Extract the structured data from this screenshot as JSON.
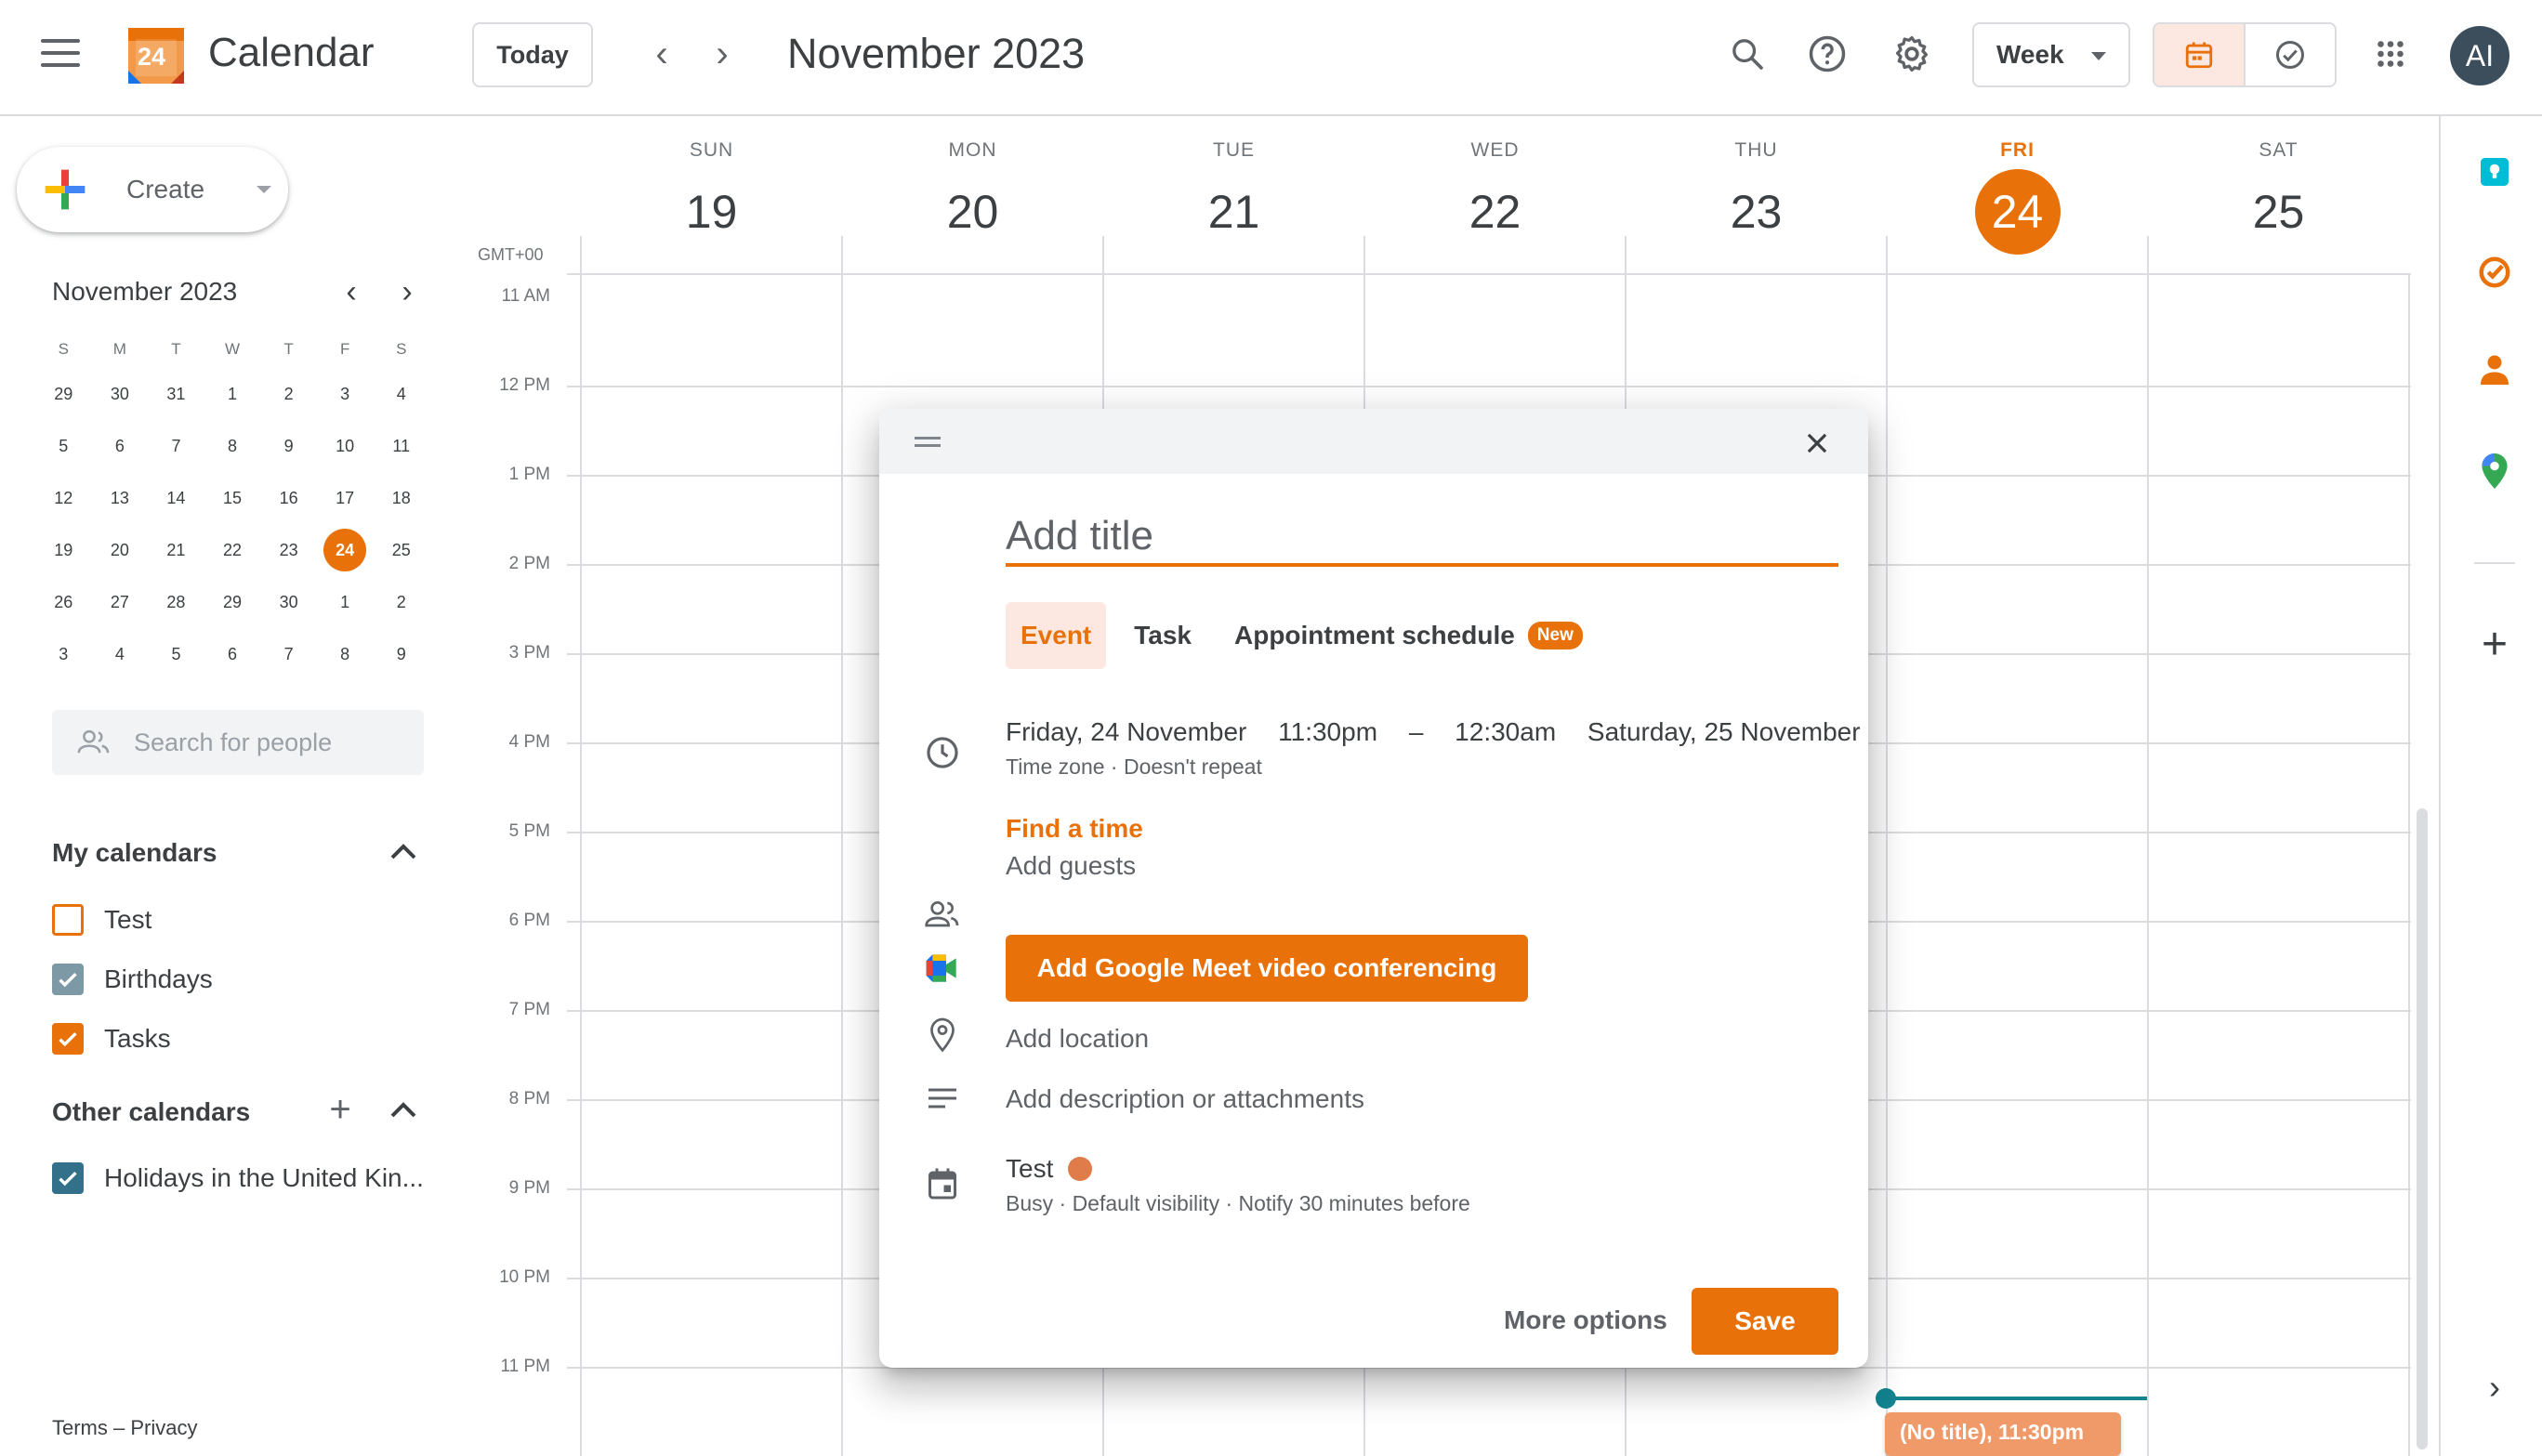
{
  "header": {
    "app_title": "Calendar",
    "logo_day": "24",
    "today_label": "Today",
    "current_period": "November 2023",
    "view_label": "Week",
    "avatar_initials": "AI",
    "accent_color": "#e8710a"
  },
  "sidebar": {
    "create_label": "Create",
    "mini_calendar": {
      "title": "November 2023",
      "weekdays": [
        "S",
        "M",
        "T",
        "W",
        "T",
        "F",
        "S"
      ],
      "weeks": [
        [
          "29",
          "30",
          "31",
          "1",
          "2",
          "3",
          "4"
        ],
        [
          "5",
          "6",
          "7",
          "8",
          "9",
          "10",
          "11"
        ],
        [
          "12",
          "13",
          "14",
          "15",
          "16",
          "17",
          "18"
        ],
        [
          "19",
          "20",
          "21",
          "22",
          "23",
          "24",
          "25"
        ],
        [
          "26",
          "27",
          "28",
          "29",
          "30",
          "1",
          "2"
        ],
        [
          "3",
          "4",
          "5",
          "6",
          "7",
          "8",
          "9"
        ]
      ],
      "selected_day": "24"
    },
    "people_search_placeholder": "Search for people",
    "my_calendars_title": "My calendars",
    "my_calendars": [
      {
        "label": "Test",
        "checked": false,
        "color": "#e8710a"
      },
      {
        "label": "Birthdays",
        "checked": true,
        "color": "#7e99a6"
      },
      {
        "label": "Tasks",
        "checked": true,
        "color": "#e8710a"
      }
    ],
    "other_calendars_title": "Other calendars",
    "other_calendars": [
      {
        "label": "Holidays in the United Kin...",
        "checked": true,
        "color": "#33708a"
      }
    ],
    "footer": "Terms – Privacy"
  },
  "week": {
    "timezone": "GMT+00",
    "days": [
      {
        "dow": "SUN",
        "num": "19",
        "today": false
      },
      {
        "dow": "MON",
        "num": "20",
        "today": false
      },
      {
        "dow": "TUE",
        "num": "21",
        "today": false
      },
      {
        "dow": "WED",
        "num": "22",
        "today": false
      },
      {
        "dow": "THU",
        "num": "23",
        "today": false
      },
      {
        "dow": "FRI",
        "num": "24",
        "today": true
      },
      {
        "dow": "SAT",
        "num": "25",
        "today": false
      }
    ],
    "hours": [
      "11 AM",
      "12 PM",
      "1 PM",
      "2 PM",
      "3 PM",
      "4 PM",
      "5 PM",
      "6 PM",
      "7 PM",
      "8 PM",
      "9 PM",
      "10 PM",
      "11 PM"
    ],
    "draft_event": "(No title), 11:30pm"
  },
  "dialog": {
    "title_placeholder": "Add title",
    "tabs": [
      "Event",
      "Task",
      "Appointment schedule"
    ],
    "new_badge": "New",
    "start_date": "Friday, 24 November",
    "start_time": "11:30pm",
    "dash": "–",
    "end_time": "12:30am",
    "end_date": "Saturday, 25 November",
    "time_sub": "Time zone · Doesn't repeat",
    "find_time": "Find a time",
    "add_guests": "Add guests",
    "meet_button": "Add Google Meet video conferencing",
    "add_location": "Add location",
    "add_description": "Add description or attachments",
    "calendar_name": "Test",
    "calendar_sub": "Busy · Default visibility · Notify 30 minutes before",
    "more_options": "More options",
    "save": "Save"
  }
}
